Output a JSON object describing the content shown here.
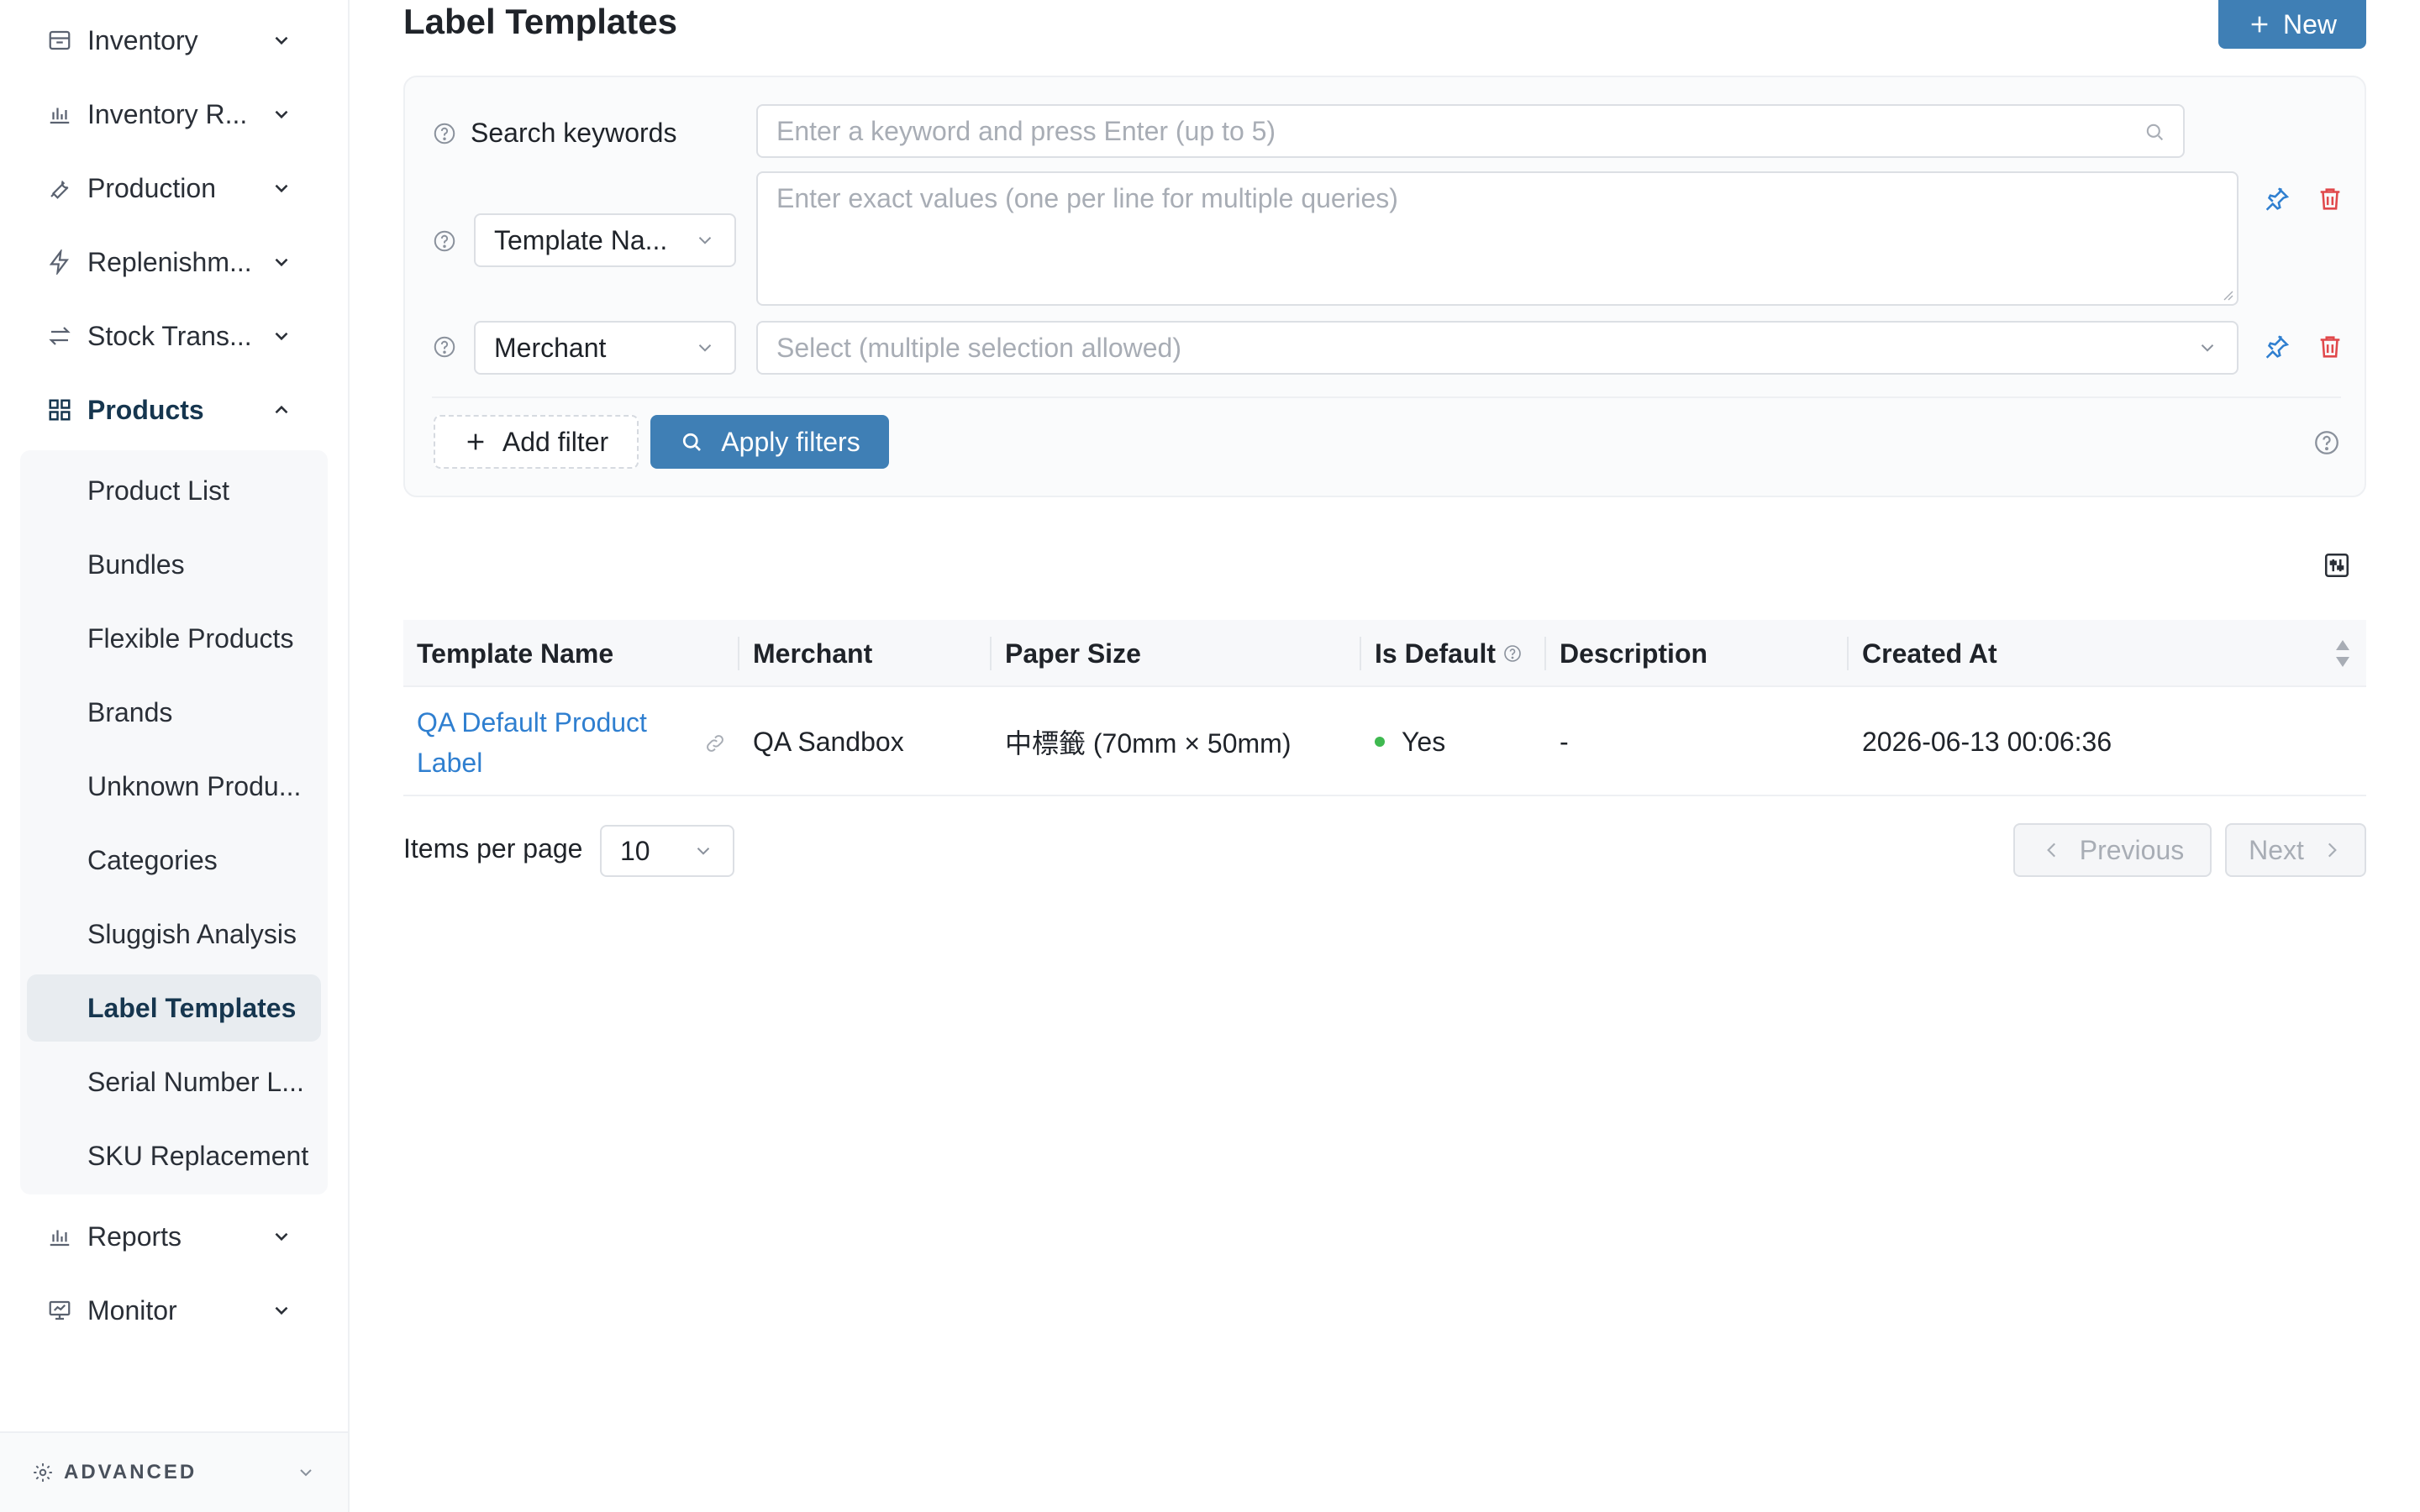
{
  "sidebar": {
    "items": [
      {
        "label": "Inventory",
        "icon": "inventory-icon"
      },
      {
        "label": "Inventory R...",
        "icon": "bar-chart-icon"
      },
      {
        "label": "Production",
        "icon": "wrench-icon"
      },
      {
        "label": "Replenishm...",
        "icon": "lightning-icon"
      },
      {
        "label": "Stock Trans...",
        "icon": "transfer-icon"
      },
      {
        "label": "Products",
        "icon": "grid-icon"
      },
      {
        "label": "Reports",
        "icon": "bar-chart-icon"
      },
      {
        "label": "Monitor",
        "icon": "monitor-icon"
      }
    ],
    "products_sub": [
      "Product List",
      "Bundles",
      "Flexible Products",
      "Brands",
      "Unknown Produ...",
      "Categories",
      "Sluggish Analysis",
      "Label Templates",
      "Serial Number L...",
      "SKU Replacement"
    ],
    "advanced_label": "ADVANCED"
  },
  "header": {
    "title": "Label Templates",
    "new_label": "New"
  },
  "filters": {
    "search_label": "Search keywords",
    "search_placeholder": "Enter a keyword and press Enter (up to 5)",
    "field1_select": "Template Na...",
    "field1_placeholder": "Enter exact values (one per line for multiple queries)",
    "field2_select": "Merchant",
    "field2_placeholder": "Select (multiple selection allowed)",
    "add_filter_label": "Add filter",
    "apply_label": "Apply filters"
  },
  "table": {
    "columns": [
      "Template Name",
      "Merchant",
      "Paper Size",
      "Is Default",
      "Description",
      "Created At"
    ],
    "rows": [
      {
        "template_name": "QA Default Product Label",
        "merchant": "QA Sandbox",
        "paper_size": "中標籤 (70mm × 50mm)",
        "is_default": "Yes",
        "description": "-",
        "created_at": "2026-06-13 00:06:36"
      }
    ]
  },
  "pagination": {
    "items_per_page_label": "Items per page",
    "items_per_page": "10",
    "previous_label": "Previous",
    "next_label": "Next"
  },
  "colors": {
    "primary": "#3f7fb5",
    "link": "#2f7fd0",
    "danger": "#e0484b",
    "success": "#3fb950"
  }
}
